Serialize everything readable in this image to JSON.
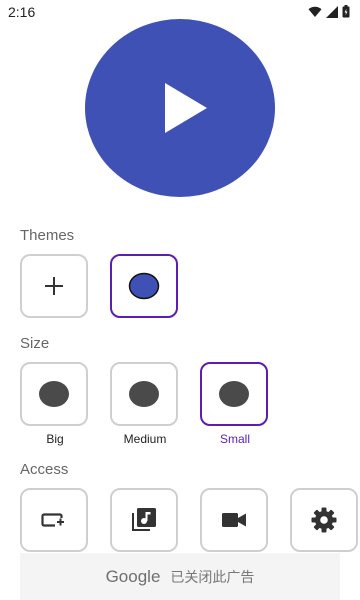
{
  "status": {
    "time": "2:16"
  },
  "colors": {
    "accent": "#3f51b5",
    "selected_border": "#5a1fb0",
    "tile_border": "#cfcfcf",
    "dot": "#4a4a4a"
  },
  "themes": {
    "label": "Themes",
    "items": [
      {
        "icon": "plus-icon"
      },
      {
        "icon": "color-dot",
        "color": "#3f51b5",
        "selected": true
      }
    ]
  },
  "size": {
    "label": "Size",
    "items": [
      {
        "label": "Big",
        "selected": false
      },
      {
        "label": "Medium",
        "selected": false
      },
      {
        "label": "Small",
        "selected": true
      }
    ]
  },
  "access": {
    "label": "Access",
    "items": [
      {
        "icon": "screen-add-icon"
      },
      {
        "icon": "music-library-icon"
      },
      {
        "icon": "video-camera-icon"
      },
      {
        "icon": "gear-icon"
      }
    ]
  },
  "ad": {
    "brand": "Google",
    "text": "已关闭此广告"
  }
}
